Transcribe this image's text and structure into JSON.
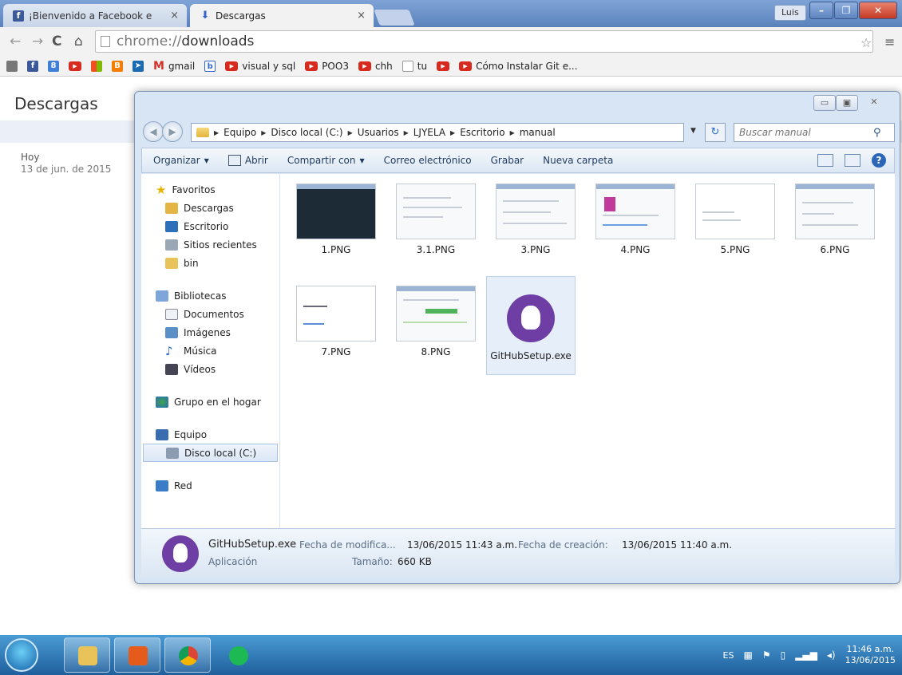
{
  "tabs": [
    {
      "label": "¡Bienvenido a Facebook e",
      "icon": "facebook-icon"
    },
    {
      "label": "Descargas",
      "icon": "download-icon"
    }
  ],
  "user_badge": "Luis",
  "omnibox": {
    "scheme": "chrome://",
    "host": "downloads"
  },
  "bookmarks": [
    {
      "label": "",
      "icon": "apps-icon"
    },
    {
      "label": "",
      "icon": "facebook-icon"
    },
    {
      "label": "",
      "icon": "google-plus-icon"
    },
    {
      "label": "",
      "icon": "youtube-icon"
    },
    {
      "label": "",
      "icon": "windows-icon"
    },
    {
      "label": "",
      "icon": "blogger-icon"
    },
    {
      "label": "",
      "icon": "bird-icon"
    },
    {
      "label": "gmail",
      "icon": "gmail-icon"
    },
    {
      "label": "",
      "icon": "bookmark-b-icon"
    },
    {
      "label": "visual y sql",
      "icon": "youtube-icon"
    },
    {
      "label": "POO3",
      "icon": "youtube-icon"
    },
    {
      "label": "chh",
      "icon": "youtube-icon"
    },
    {
      "label": "tu",
      "icon": "page-icon"
    },
    {
      "label": "",
      "icon": "youtube-icon"
    },
    {
      "label": "Cómo Instalar Git e...",
      "icon": "youtube-icon"
    }
  ],
  "downloads_page": {
    "title": "Descargas",
    "date_label": "Hoy",
    "date_full": "13 de jun. de 2015"
  },
  "explorer": {
    "breadcrumb": [
      "Equipo",
      "Disco local (C:)",
      "Usuarios",
      "LJYELA",
      "Escritorio",
      "manual"
    ],
    "search_placeholder": "Buscar manual",
    "commands": [
      "Organizar",
      "Abrir",
      "Compartir con",
      "Correo electrónico",
      "Grabar",
      "Nueva carpeta"
    ],
    "nav": {
      "favorites_header": "Favoritos",
      "favorites": [
        "Descargas",
        "Escritorio",
        "Sitios recientes",
        "bin"
      ],
      "libraries_header": "Bibliotecas",
      "libraries": [
        "Documentos",
        "Imágenes",
        "Música",
        "Vídeos"
      ],
      "homegroup": "Grupo en el hogar",
      "computer_header": "Equipo",
      "computer": [
        "Disco local (C:)"
      ],
      "network": "Red"
    },
    "files": [
      {
        "name": "1.PNG"
      },
      {
        "name": "3.1.PNG"
      },
      {
        "name": "3.PNG"
      },
      {
        "name": "4.PNG"
      },
      {
        "name": "5.PNG"
      },
      {
        "name": "6.PNG"
      },
      {
        "name": "7.PNG"
      },
      {
        "name": "8.PNG"
      },
      {
        "name": "GitHubSetup.exe"
      }
    ],
    "details": {
      "name": "GitHubSetup.exe",
      "type": "Aplicación",
      "modified_label": "Fecha de modifica...",
      "modified_value": "13/06/2015 11:43 a.m.",
      "created_label": "Fecha de creación:",
      "created_value": "13/06/2015 11:40 a.m.",
      "size_label": "Tamaño:",
      "size_value": "660 KB"
    }
  },
  "taskbar": {
    "apps": [
      "explorer-icon",
      "office-icon",
      "chrome-icon",
      "spotify-icon"
    ],
    "lang": "ES",
    "time": "11:46 a.m.",
    "date": "13/06/2015"
  }
}
